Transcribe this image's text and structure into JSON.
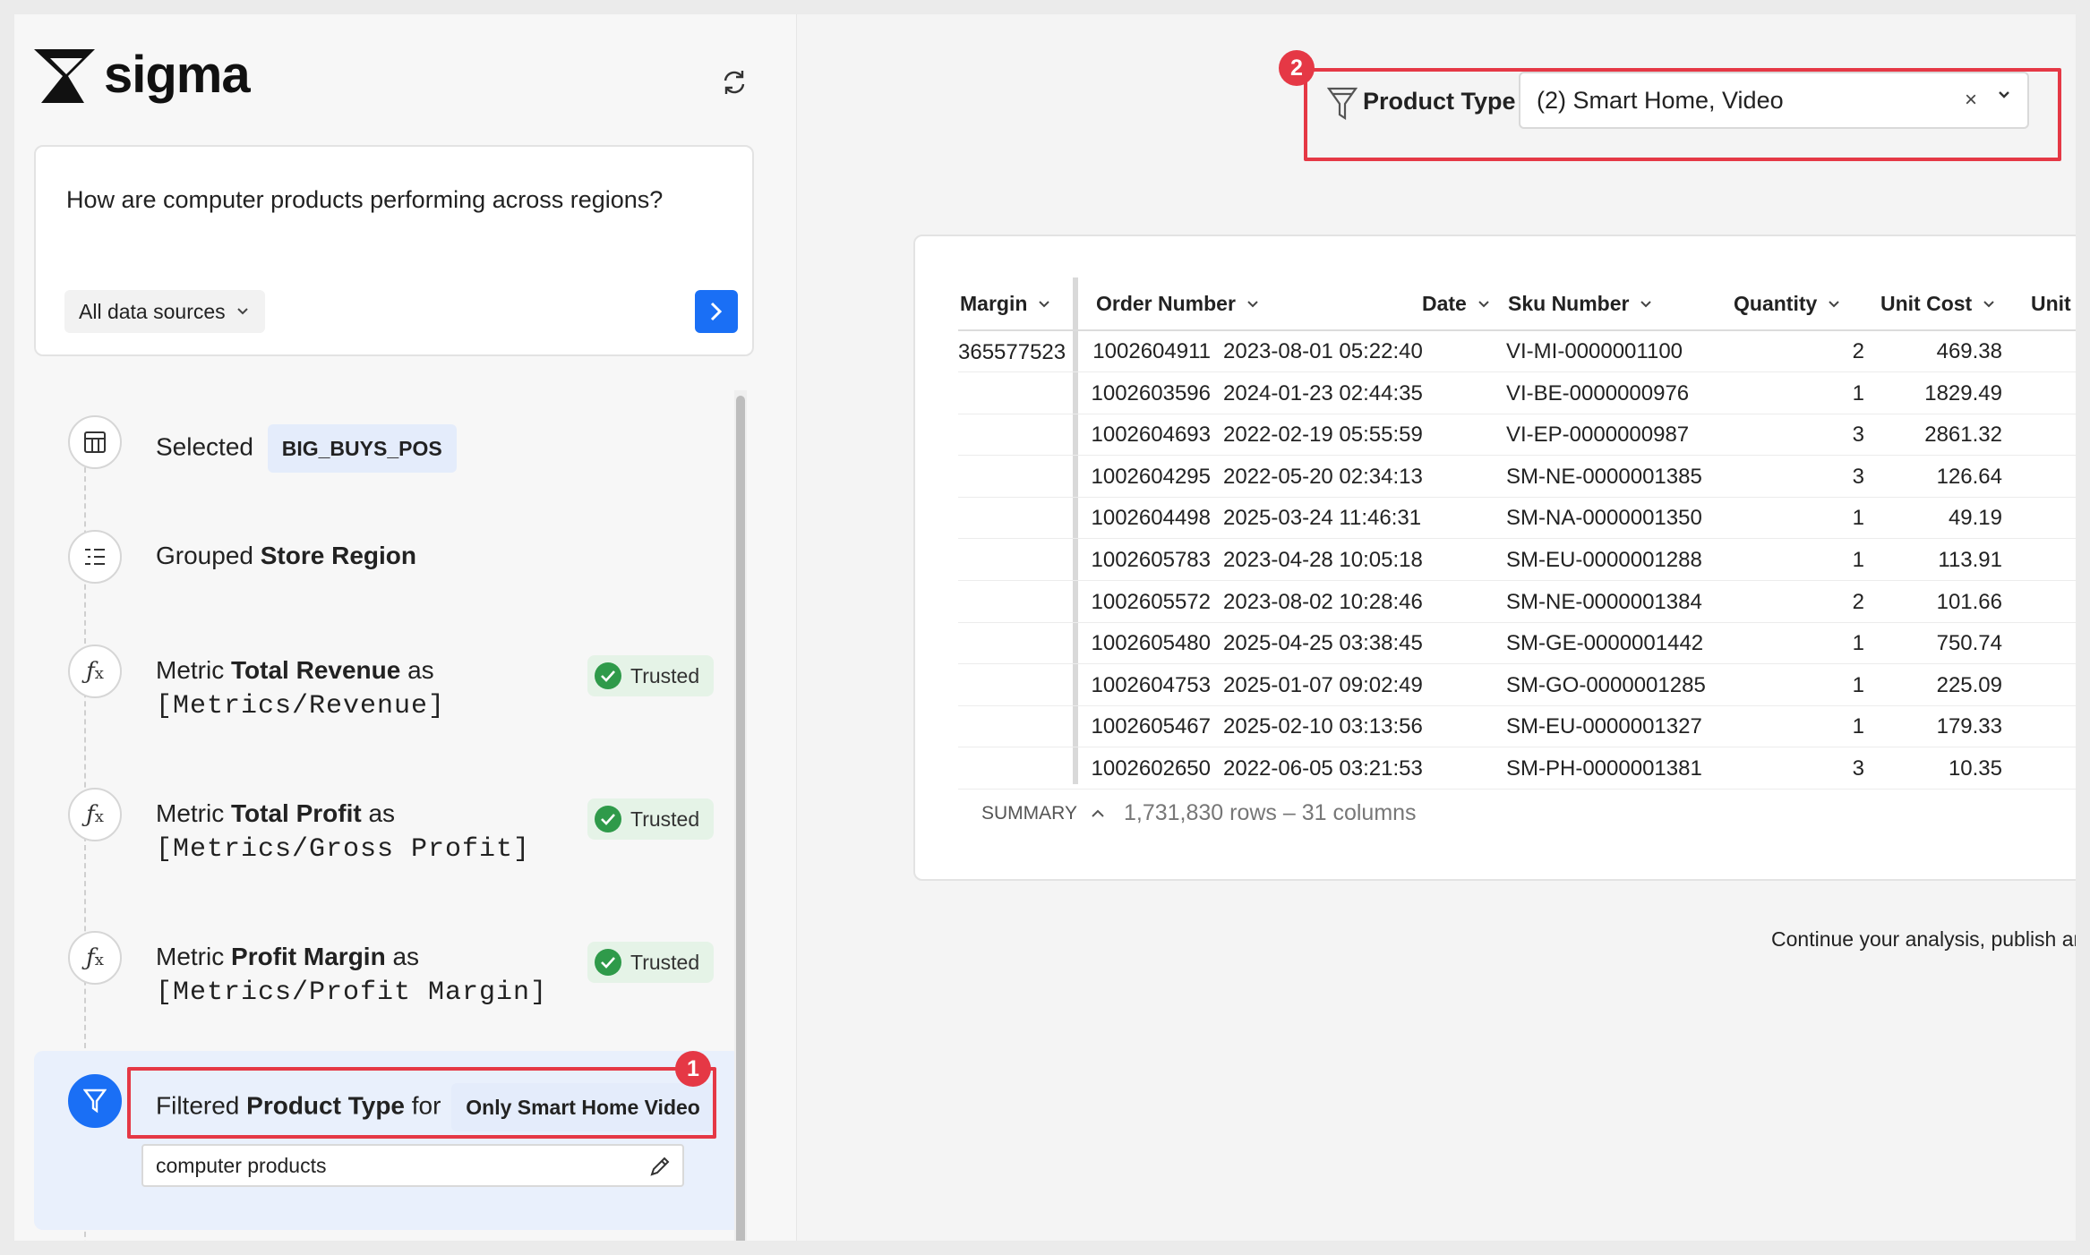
{
  "app": {
    "logo_text": "sigma"
  },
  "prompt": {
    "question": "How are computer products performing across regions?",
    "sources_label": "All data sources"
  },
  "steps": [
    {
      "prefix": "Selected",
      "chip": "BIG_BUYS_POS"
    },
    {
      "prefix": "Grouped",
      "bold": "Store Region"
    },
    {
      "prefix": "Metric",
      "bold": "Total Revenue",
      "suffix": "as",
      "formula": "[Metrics/Revenue]",
      "badge": "Trusted"
    },
    {
      "prefix": "Metric",
      "bold": "Total Profit",
      "suffix": "as",
      "formula": "[Metrics/Gross Profit]",
      "badge": "Trusted"
    },
    {
      "prefix": "Metric",
      "bold": "Profit Margin",
      "suffix": "as",
      "formula": "[Metrics/Profit Margin]",
      "badge": "Trusted"
    },
    {
      "prefix": "Filtered",
      "bold": "Product Type",
      "suffix": "for",
      "chip": "Only Smart Home Video",
      "input_value": "computer products"
    }
  ],
  "annotations": {
    "one": "1",
    "two": "2"
  },
  "filter": {
    "label": "Product Type",
    "value": "(2) Smart Home, Video",
    "clear": "×"
  },
  "table": {
    "columns": [
      "Margin",
      "Order Number",
      "Date",
      "Sku Number",
      "Quantity",
      "Unit Cost",
      "Unit F"
    ],
    "first_margin": "365577523",
    "rows": [
      [
        "1002604911",
        "2023-08-01 05:22:40",
        "VI-MI-0000001100",
        "2",
        "469.38"
      ],
      [
        "1002603596",
        "2024-01-23 02:44:35",
        "VI-BE-0000000976",
        "1",
        "1829.49"
      ],
      [
        "1002604693",
        "2022-02-19 05:55:59",
        "VI-EP-0000000987",
        "3",
        "2861.32"
      ],
      [
        "1002604295",
        "2022-05-20 02:34:13",
        "SM-NE-0000001385",
        "3",
        "126.64"
      ],
      [
        "1002604498",
        "2025-03-24 11:46:31",
        "SM-NA-0000001350",
        "1",
        "49.19"
      ],
      [
        "1002605783",
        "2023-04-28 10:05:18",
        "SM-EU-0000001288",
        "1",
        "113.91"
      ],
      [
        "1002605572",
        "2023-08-02 10:28:46",
        "SM-NE-0000001384",
        "2",
        "101.66"
      ],
      [
        "1002605480",
        "2025-04-25 03:38:45",
        "SM-GE-0000001442",
        "1",
        "750.74"
      ],
      [
        "1002604753",
        "2025-01-07 09:02:49",
        "SM-GO-0000001285",
        "1",
        "225.09"
      ],
      [
        "1002605467",
        "2025-02-10 03:13:56",
        "SM-EU-0000001327",
        "1",
        "179.33"
      ],
      [
        "1002602650",
        "2022-06-05 03:21:53",
        "SM-PH-0000001381",
        "3",
        "10.35"
      ]
    ],
    "summary_label": "SUMMARY",
    "summary_count": "1,731,830 rows – 31 columns"
  },
  "footer": {
    "continue_text": "Continue your analysis, publish and"
  },
  "colors": {
    "accent": "#1a6ff5",
    "annotation": "#e53845",
    "trusted_bg": "#e5f3e7",
    "trusted_check": "#2f9a4a"
  }
}
